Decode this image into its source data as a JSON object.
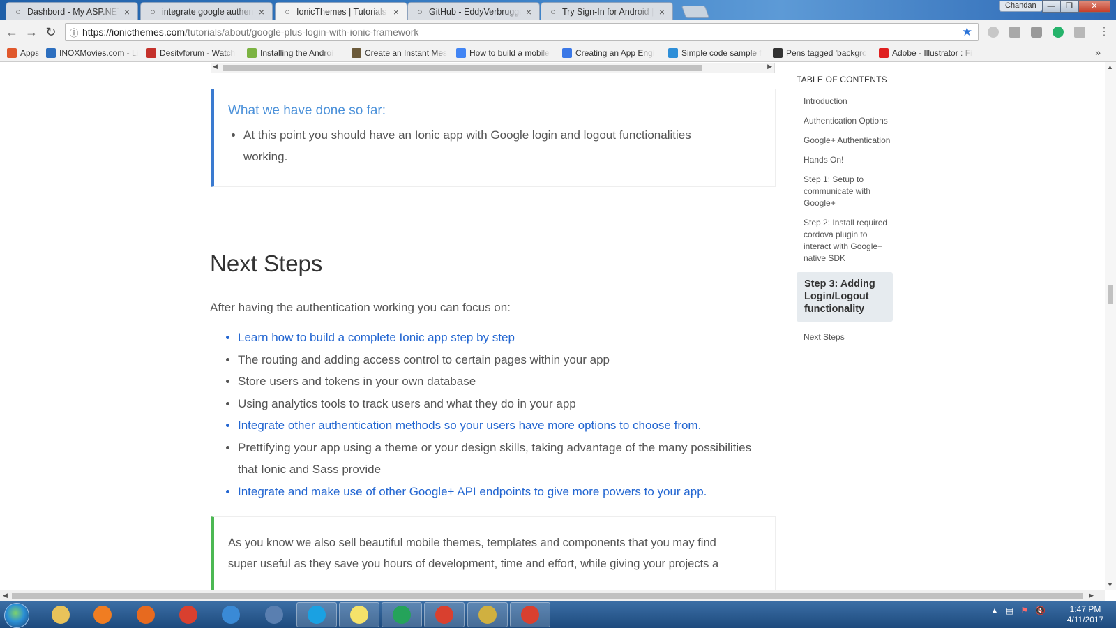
{
  "browser": {
    "tabs": [
      {
        "title": "Dashbord - My ASP.NET",
        "favicon": "page-icon",
        "active": false
      },
      {
        "title": "integrate google authent",
        "favicon": "google-icon",
        "active": false
      },
      {
        "title": "IonicThemes | Tutorials |",
        "favicon": "ionic-icon",
        "active": true
      },
      {
        "title": "GitHub - EddyVerbrugge",
        "favicon": "github-icon",
        "active": false
      },
      {
        "title": "Try Sign-In for Android |",
        "favicon": "google-dev-icon",
        "active": false
      }
    ],
    "profile_name": "Chandan",
    "url_host": "https://ionicthemes.com",
    "url_path": "/tutorials/about/google-plus-login-with-ionic-framework",
    "bookmarks": [
      {
        "label": "Apps",
        "icon": "apps-grid-icon",
        "color": "#e0582c"
      },
      {
        "label": "INOXMovies.com - Li",
        "icon": "inox-icon",
        "color": "#2d6fbf"
      },
      {
        "label": "Desitvforum - Watch",
        "icon": "desitv-icon",
        "color": "#c4312b"
      },
      {
        "label": "Installing the Androi",
        "icon": "android-icon",
        "color": "#7cb342"
      },
      {
        "label": "Create an Instant Mes",
        "icon": "tutorial-icon",
        "color": "#6b5a3a"
      },
      {
        "label": "How to build a mobile",
        "icon": "chrome-dev-icon",
        "color": "#4285f4"
      },
      {
        "label": "Creating an App Engi",
        "icon": "app-engine-icon",
        "color": "#3b78e7"
      },
      {
        "label": "Simple code sample f",
        "icon": "windows-icon",
        "color": "#2f8fd8"
      },
      {
        "label": "Pens tagged 'backgro",
        "icon": "codepen-icon",
        "color": "#333333"
      },
      {
        "label": "Adobe - Illustrator : Fi",
        "icon": "adobe-icon",
        "color": "#e02020"
      }
    ]
  },
  "page": {
    "callout_done": {
      "title": "What we have done so far:",
      "items": [
        "At this point you should have an Ionic app with Google login and logout functionalities working."
      ]
    },
    "next_steps": {
      "heading": "Next Steps",
      "intro": "After having the authentication working you can focus on:",
      "items": [
        {
          "text": "Learn how to build a complete Ionic app step by step",
          "link": true
        },
        {
          "text": "The routing and adding access control to certain pages within your app",
          "link": false
        },
        {
          "text": "Store users and tokens in your own database",
          "link": false
        },
        {
          "text": "Using analytics tools to track users and what they do in your app",
          "link": false
        },
        {
          "text": "Integrate other authentication methods so your users have more options to choose from.",
          "link": true
        },
        {
          "text": "Prettifying your app using a theme or your design skills, taking advantage of the many possibilities that Ionic and Sass provide",
          "link": false
        },
        {
          "text": "Integrate and make use of other Google+ API endpoints to give more powers to your app.",
          "link": true
        }
      ]
    },
    "callout_themes": {
      "text": "As you know we also sell beautiful mobile themes, templates and components that you may find super useful as they save you hours of development, time and effort, while giving your projects a"
    },
    "toc": {
      "title": "TABLE OF CONTENTS",
      "items": [
        {
          "label": "Introduction",
          "active": false
        },
        {
          "label": "Authentication Options",
          "active": false
        },
        {
          "label": "Google+ Authentication",
          "active": false
        },
        {
          "label": "Hands On!",
          "active": false
        },
        {
          "label": "Step 1: Setup to communicate with Google+",
          "active": false
        },
        {
          "label": "Step 2: Install required cordova plugin to interact with Google+ native SDK",
          "active": false
        },
        {
          "label": "Step 3: Adding Login/Logout functionality",
          "active": true
        },
        {
          "label": "Next Steps",
          "active": false
        }
      ]
    }
  },
  "taskbar": {
    "apps": [
      {
        "name": "file-explorer-icon",
        "color": "#e8c35a",
        "open": false
      },
      {
        "name": "media-player-icon",
        "color": "#f07d22",
        "open": false
      },
      {
        "name": "firefox-icon",
        "color": "#e76a1f",
        "open": false
      },
      {
        "name": "chrome-icon",
        "color": "#d9402f",
        "open": false
      },
      {
        "name": "internet-explorer-icon",
        "color": "#3a8ad6",
        "open": false
      },
      {
        "name": "network-tool-icon",
        "color": "#5a7fb0",
        "open": false
      },
      {
        "name": "skype-icon",
        "color": "#1aa1e2",
        "open": true
      },
      {
        "name": "sticky-notes-icon",
        "color": "#f5e26a",
        "open": true
      },
      {
        "name": "visual-studio-code-icon",
        "color": "#25a35a",
        "open": true
      },
      {
        "name": "chrome-icon",
        "color": "#d9402f",
        "open": true
      },
      {
        "name": "snipping-tool-icon",
        "color": "#d0b040",
        "open": true
      },
      {
        "name": "chrome-icon",
        "color": "#d9402f",
        "open": true
      }
    ],
    "time": "1:47 PM",
    "date": "4/11/2017"
  }
}
